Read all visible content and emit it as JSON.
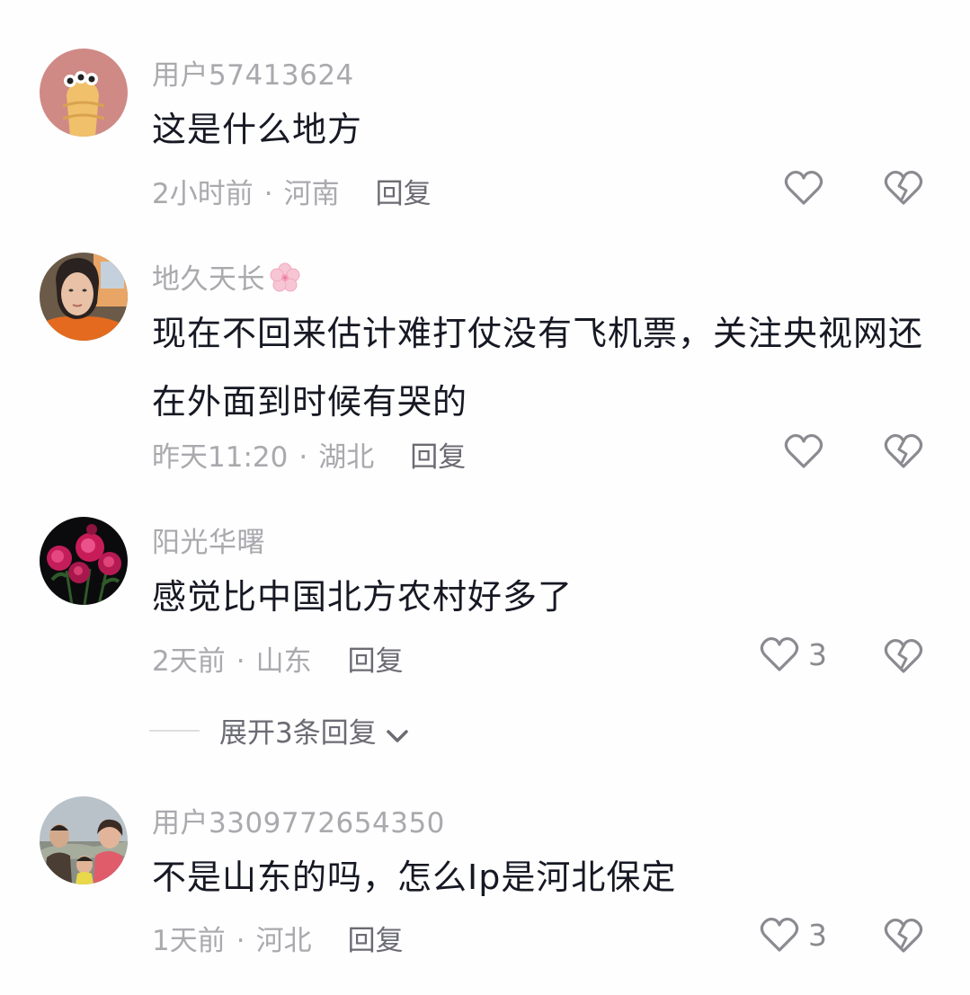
{
  "comments": [
    {
      "username": "用户57413624",
      "text": "这是什么地方",
      "time": "2小时前",
      "location": "河南",
      "reply_label": "回复",
      "likes": ""
    },
    {
      "username": "地久天长",
      "text": "现在不回来估计难打仗没有飞机票，关注央视网还在外面到时候有哭的",
      "time": "昨天11:20",
      "location": "湖北",
      "reply_label": "回复",
      "likes": ""
    },
    {
      "username": "阳光华曙",
      "text": "感觉比中国北方农村好多了",
      "time": "2天前",
      "location": "山东",
      "reply_label": "回复",
      "likes": "3",
      "expand_label": "展开3条回复"
    },
    {
      "username": "用户3309772654350",
      "text": "不是山东的吗，怎么Ip是河北保定",
      "time": "1天前",
      "location": "河北",
      "reply_label": "回复",
      "likes": "3"
    }
  ],
  "separator": "·",
  "colors": {
    "username": "#a9a9ae",
    "text": "#161823",
    "meta": "#a9a9ae",
    "icon": "#8a8a90"
  },
  "icons": {
    "like": "heart-icon",
    "dislike": "broken-heart-icon",
    "expand": "chevron-down-icon",
    "emoji": "cherry-blossom-icon"
  }
}
